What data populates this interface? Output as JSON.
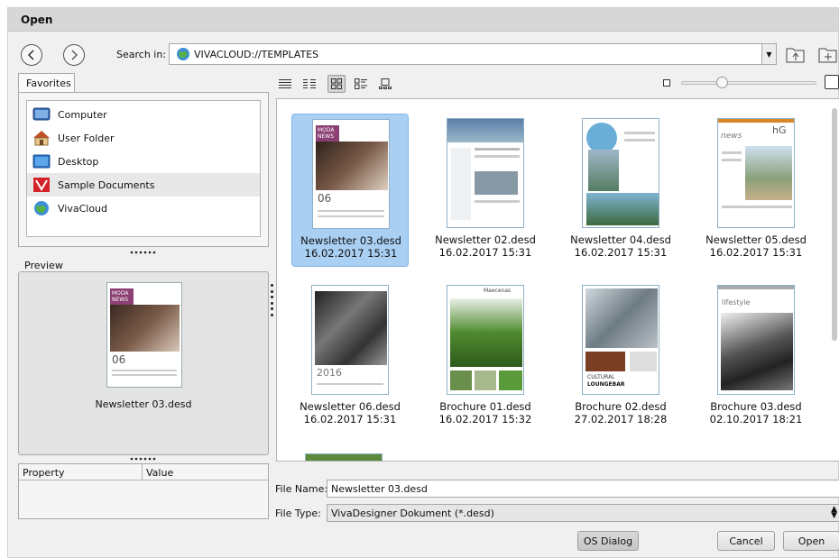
{
  "window": {
    "title": "Open"
  },
  "toolbar": {
    "search_label": "Search in:",
    "search_path": "VIVACLOUD://TEMPLATES",
    "icons": [
      "back-icon",
      "forward-icon",
      "dropdown-arrow-icon",
      "folder-up-icon",
      "new-folder-icon"
    ]
  },
  "favorites": {
    "tab_label": "Favorites",
    "items": [
      {
        "label": "Computer",
        "icon": "computer-icon"
      },
      {
        "label": "User Folder",
        "icon": "home-icon"
      },
      {
        "label": "Desktop",
        "icon": "desktop-icon"
      },
      {
        "label": "Sample Documents",
        "icon": "sample-docs-icon",
        "selected": true
      },
      {
        "label": "VivaCloud",
        "icon": "vivacloud-icon"
      }
    ]
  },
  "preview": {
    "label": "Preview",
    "file_name": "Newsletter 03.desd"
  },
  "properties": {
    "col_property": "Property",
    "col_value": "Value"
  },
  "view_modes": [
    "list-view-icon",
    "detail-view-icon",
    "icon-view-icon",
    "tile-view-icon",
    "thumbnail-view-icon"
  ],
  "zoom": {
    "level": 0.3
  },
  "files": [
    {
      "name": "Newsletter 03.desd",
      "date": "16.02.2017 15:31",
      "selected": true,
      "style": "moda"
    },
    {
      "name": "Newsletter 02.desd",
      "date": "16.02.2017 15:31",
      "style": "report"
    },
    {
      "name": "Newsletter 04.desd",
      "date": "16.02.2017 15:31",
      "style": "blue"
    },
    {
      "name": "Newsletter 05.desd",
      "date": "16.02.2017 15:31",
      "style": "news"
    },
    {
      "name": "Newsletter 06.desd",
      "date": "16.02.2017 15:31",
      "style": "crowd"
    },
    {
      "name": "Brochure 01.desd",
      "date": "16.02.2017 15:32",
      "style": "garden"
    },
    {
      "name": "Brochure 02.desd",
      "date": "27.02.2017 18:28",
      "style": "lounge"
    },
    {
      "name": "Brochure 03.desd",
      "date": "02.10.2017 18:21",
      "style": "lifestyle"
    }
  ],
  "form": {
    "file_name_label": "File Name:",
    "file_name_value": "Newsletter 03.desd",
    "file_type_label": "File Type:",
    "file_type_value": "VivaDesigner Dokument (*.desd)"
  },
  "buttons": {
    "os_dialog": "OS Dialog",
    "cancel": "Cancel",
    "open": "Open"
  },
  "thumb_text": {
    "moda_brand": "MODA",
    "moda_sub": "NEWS",
    "moda_num": "06",
    "news_word": "news",
    "news_logo": "hG",
    "year": "2016",
    "maecenas": "Maecenas",
    "cultural": "CULTURAL",
    "loungebar": "LOUNGEBAR",
    "lifestyle": "lifestyle"
  }
}
